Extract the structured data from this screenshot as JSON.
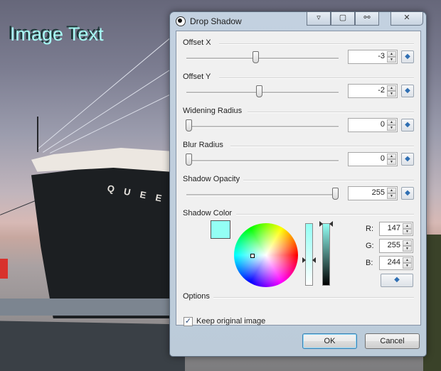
{
  "background": {
    "overlay_text": "Image Text",
    "ship_name": "Q U E E N"
  },
  "dialog": {
    "title": "Drop Shadow",
    "title_buttons": [
      "▿",
      "▢",
      "⚯",
      "✕"
    ],
    "offset_x": {
      "label": "Offset X",
      "value": "-3",
      "slider_fraction": 0.46
    },
    "offset_y": {
      "label": "Offset Y",
      "value": "-2",
      "slider_fraction": 0.48
    },
    "widening_radius": {
      "label": "Widening Radius",
      "value": "0",
      "slider_fraction": 0.02
    },
    "blur_radius": {
      "label": "Blur Radius",
      "value": "0",
      "slider_fraction": 0.02
    },
    "shadow_opacity": {
      "label": "Shadow Opacity",
      "value": "255",
      "slider_fraction": 0.98
    },
    "shadow_color": {
      "label": "Shadow Color",
      "swatch_color": "#93fff4",
      "r_label": "R:",
      "r_value": "147",
      "g_label": "G:",
      "g_value": "255",
      "b_label": "B:",
      "b_value": "244"
    },
    "options": {
      "label": "Options",
      "keep_original_label": "Keep original image",
      "keep_original_checked": true,
      "check_glyph": "✓"
    },
    "ok_label": "OK",
    "cancel_label": "Cancel",
    "spin_up_glyph": "▲",
    "spin_down_glyph": "▼",
    "reset_glyph": "◆"
  },
  "colors": {
    "accent": "#3c7fb1",
    "reset_arrow": "#2f6fb3"
  }
}
